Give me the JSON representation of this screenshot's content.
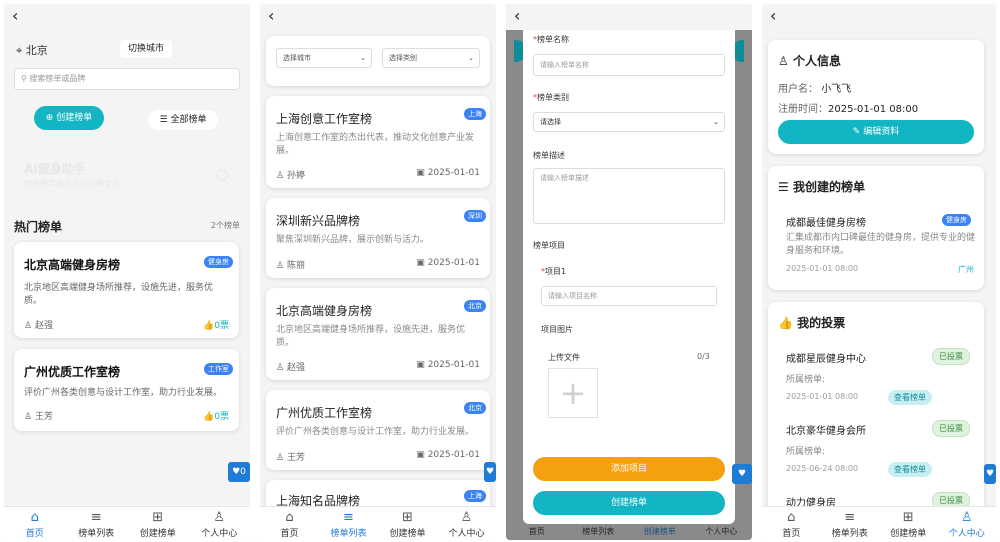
{
  "home": {
    "location": "北京",
    "switch_city": "切换城市",
    "search_placeholder": "搜索榜单或品牌",
    "create_btn": "创建榜单",
    "all_btn": "全部榜单",
    "ai_title": "AI健身助手",
    "ai_sub": "智能推荐最适合您的健身房",
    "hot_title": "热门榜单",
    "hot_count": "2个榜单",
    "cards": [
      {
        "title": "北京高端健身房榜",
        "badge": "健身房",
        "desc": "北京地区高端健身场所推荐，设施先进，服务优质。",
        "user": "赵强",
        "votes": "0票"
      },
      {
        "title": "广州优质工作室榜",
        "badge": "工作室",
        "desc": "评价广州各类创意与设计工作室，助力行业发展。",
        "user": "王芳",
        "votes": "0票"
      }
    ],
    "heart_count": "0"
  },
  "list": {
    "city_select": "选择城市",
    "type_select": "选择类别",
    "cards": [
      {
        "title": "上海创意工作室榜",
        "badge": "上海",
        "desc": "上海创意工作室的杰出代表，推动文化创意产业发展。",
        "user": "孙婷",
        "date": "2025-01-01"
      },
      {
        "title": "深圳新兴品牌榜",
        "badge": "深圳",
        "desc": "聚焦深圳新兴品牌，展示创新与活力。",
        "user": "陈丽",
        "date": "2025-01-01"
      },
      {
        "title": "北京高端健身房榜",
        "badge": "北京",
        "desc": "北京地区高端健身场所推荐，设施先进，服务优质。",
        "user": "赵强",
        "date": "2025-01-01"
      },
      {
        "title": "广州优质工作室榜",
        "badge": "北京",
        "desc": "评价广州各类创意与设计工作室，助力行业发展。",
        "user": "王芳",
        "date": "2025-01-01"
      },
      {
        "title": "上海知名品牌榜",
        "badge": "上海"
      }
    ]
  },
  "create": {
    "name_label": "榜单名称",
    "name_placeholder": "请输入榜单名称",
    "type_label": "榜单类别",
    "type_value": "请选择",
    "desc_label": "榜单描述",
    "desc_placeholder": "请输入榜单描述",
    "items_label": "榜单项目",
    "item1_label": "项目1",
    "item1_placeholder": "请输入项目名称",
    "image_label": "项目图片",
    "upload_label": "上传文件",
    "upload_count": "0/3",
    "add_item_btn": "添加项目",
    "create_btn": "创建榜单",
    "required_mark": "*"
  },
  "profile": {
    "info_title": "个人信息",
    "username_label": "用户名：",
    "username": "小飞飞",
    "regtime_label": "注册时间：",
    "regtime": "2025-01-01 08:00",
    "edit_btn": "编辑资料",
    "my_lists_title": "我创建的榜单",
    "my_list": {
      "title": "成都最佳健身房榜",
      "badge": "健身房",
      "desc": "汇集成都市内口碑最佳的健身房，提供专业的健身服务和环境。",
      "date": "2025-01-01 08:00",
      "city": "广州"
    },
    "votes_title": "我的投票",
    "votes": [
      {
        "name": "成都星辰健身中心",
        "status": "已投票",
        "belong": "所属榜单:",
        "date": "2025-01-01 08:00",
        "view": "查看榜单"
      },
      {
        "name": "北京豪华健身会所",
        "status": "已投票",
        "belong": "所属榜单:",
        "date": "2025-06-24 08:00",
        "view": "查看榜单"
      },
      {
        "name": "动力健身房",
        "status": "已投票"
      }
    ]
  },
  "tabs": [
    "首页",
    "榜单列表",
    "创建榜单",
    "个人中心"
  ],
  "colors": {
    "accent": "#12b5c3",
    "blue": "#1e7bd6",
    "orange": "#f39c12"
  }
}
